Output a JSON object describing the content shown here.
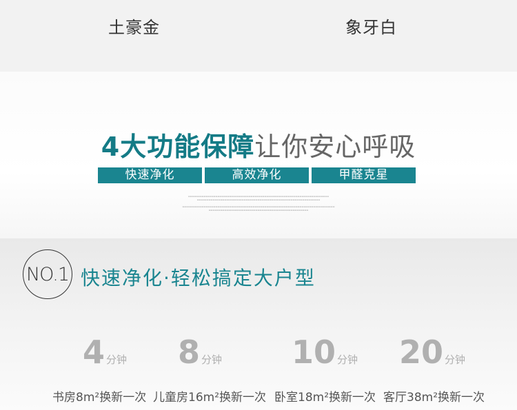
{
  "colors": {
    "accent": "#1a8590",
    "heading_accent": "#147b86",
    "number_gray": "#b0b0b0"
  },
  "color_options": [
    "土豪金",
    "象牙白"
  ],
  "headline": {
    "strong": "4大功能保障",
    "light": "让你安心呼吸"
  },
  "tags": [
    "快速净化",
    "高效净化",
    "甲醛克星"
  ],
  "section": {
    "badge": "NO.1",
    "title": "快速净化·轻松搞定大户型"
  },
  "stats": [
    {
      "number": "4",
      "unit": "分钟",
      "caption": "书房8m²换新一次"
    },
    {
      "number": "8",
      "unit": "分钟",
      "caption": "儿童房16m²换新一次"
    },
    {
      "number": "10",
      "unit": "分钟",
      "caption": "卧室18m²换新一次"
    },
    {
      "number": "20",
      "unit": "分钟",
      "caption": "客厅38m²换新一次"
    }
  ]
}
